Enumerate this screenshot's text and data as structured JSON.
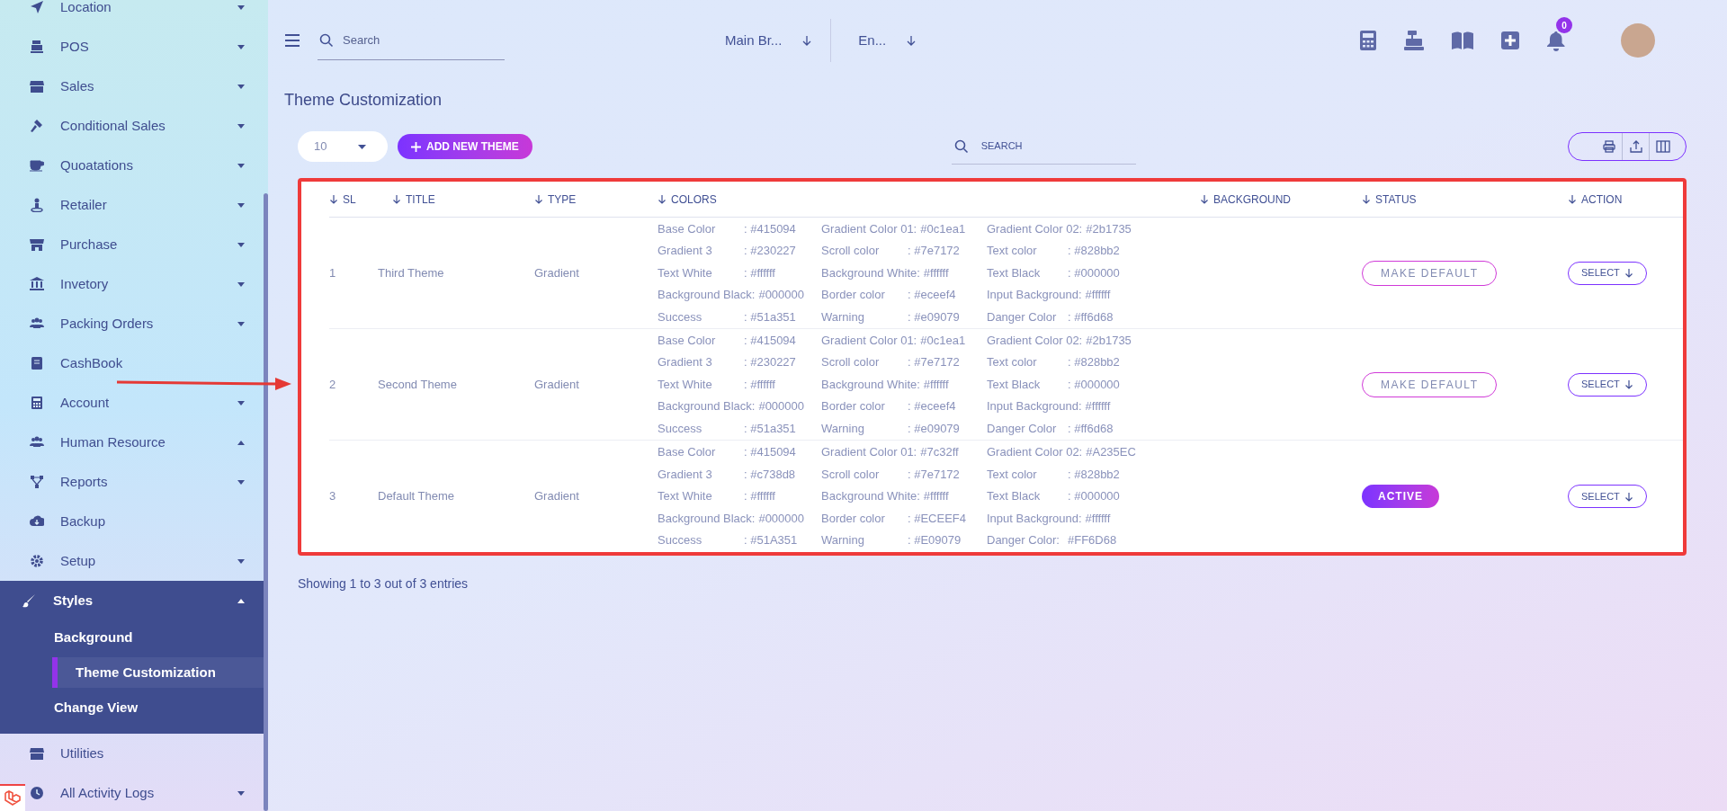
{
  "sidebar": {
    "items": [
      {
        "label": "Location",
        "kind": "dropdown",
        "expanded": false
      },
      {
        "label": "POS",
        "kind": "dropdown",
        "expanded": false
      },
      {
        "label": "Sales",
        "kind": "dropdown",
        "expanded": false
      },
      {
        "label": "Conditional Sales",
        "kind": "dropdown",
        "expanded": false
      },
      {
        "label": "Quoatations",
        "kind": "dropdown",
        "expanded": false
      },
      {
        "label": "Retailer",
        "kind": "dropdown",
        "expanded": false
      },
      {
        "label": "Purchase",
        "kind": "dropdown",
        "expanded": false
      },
      {
        "label": "Invetory",
        "kind": "dropdown",
        "expanded": false
      },
      {
        "label": "Packing Orders",
        "kind": "dropdown",
        "expanded": false
      },
      {
        "label": "CashBook",
        "kind": "link",
        "expanded": false
      },
      {
        "label": "Account",
        "kind": "dropdown",
        "expanded": false
      },
      {
        "label": "Human Resource",
        "kind": "dropup",
        "expanded": false
      },
      {
        "label": "Reports",
        "kind": "dropdown",
        "expanded": false
      },
      {
        "label": "Backup",
        "kind": "link",
        "expanded": false
      },
      {
        "label": "Setup",
        "kind": "dropdown",
        "expanded": false
      },
      {
        "label": "Styles",
        "kind": "dropup",
        "expanded": true,
        "children": [
          {
            "label": "Background",
            "selected": false
          },
          {
            "label": "Theme Customization",
            "selected": true
          },
          {
            "label": "Change View",
            "selected": false
          }
        ]
      },
      {
        "label": "Utilities",
        "kind": "link",
        "expanded": false
      },
      {
        "label": "All Activity Logs",
        "kind": "dropdown",
        "expanded": false
      }
    ]
  },
  "topbar": {
    "search": {
      "placeholder": "Search"
    },
    "branch": "Main Br...",
    "language": "En...",
    "notification_count": "0"
  },
  "page_title": "Theme Customization",
  "toolbar": {
    "page_size": "10",
    "add_button": "ADD NEW THEME",
    "search": {
      "placeholder": "SEARCH"
    }
  },
  "table": {
    "columns": [
      "SL",
      "TITLE",
      "TYPE",
      "COLORS",
      "BACKGROUND",
      "STATUS",
      "ACTION"
    ],
    "rows": [
      {
        "sl": "1",
        "title": "Third Theme",
        "type": "Gradient",
        "colors": [
          [
            {
              "label": "Base Color",
              "value": ": #415094"
            },
            {
              "label": "Gradient Color 01:",
              "value": "#0c1ea1"
            },
            {
              "label": "Gradient Color 02:",
              "value": "#2b1735"
            }
          ],
          [
            {
              "label": "Gradient 3",
              "value": ": #230227"
            },
            {
              "label": "Scroll color",
              "value": ": #7e7172"
            },
            {
              "label": "Text color",
              "value": ": #828bb2"
            }
          ],
          [
            {
              "label": "Text White",
              "value": ": #ffffff"
            },
            {
              "label": "Background White:",
              "value": "#ffffff"
            },
            {
              "label": "Text Black",
              "value": ": #000000"
            }
          ],
          [
            {
              "label": "Background Black:",
              "value": "#000000"
            },
            {
              "label": "Border color",
              "value": ": #eceef4"
            },
            {
              "label": "Input Background:",
              "value": "#ffffff"
            }
          ],
          [
            {
              "label": "Success",
              "value": ": #51a351"
            },
            {
              "label": "Warning",
              "value": ": #e09079"
            },
            {
              "label": "Danger Color",
              "value": ": #ff6d68"
            }
          ]
        ],
        "status": {
          "label": "MAKE DEFAULT",
          "active": false
        },
        "action": "SELECT"
      },
      {
        "sl": "2",
        "title": "Second Theme",
        "type": "Gradient",
        "colors": [
          [
            {
              "label": "Base Color",
              "value": ": #415094"
            },
            {
              "label": "Gradient Color 01:",
              "value": "#0c1ea1"
            },
            {
              "label": "Gradient Color 02:",
              "value": "#2b1735"
            }
          ],
          [
            {
              "label": "Gradient 3",
              "value": ": #230227"
            },
            {
              "label": "Scroll color",
              "value": ": #7e7172"
            },
            {
              "label": "Text color",
              "value": ": #828bb2"
            }
          ],
          [
            {
              "label": "Text White",
              "value": ": #ffffff"
            },
            {
              "label": "Background White:",
              "value": "#ffffff"
            },
            {
              "label": "Text Black",
              "value": ": #000000"
            }
          ],
          [
            {
              "label": "Background Black:",
              "value": "#000000"
            },
            {
              "label": "Border color",
              "value": ": #eceef4"
            },
            {
              "label": "Input Background:",
              "value": "#ffffff"
            }
          ],
          [
            {
              "label": "Success",
              "value": ": #51a351"
            },
            {
              "label": "Warning",
              "value": ": #e09079"
            },
            {
              "label": "Danger Color",
              "value": ": #ff6d68"
            }
          ]
        ],
        "status": {
          "label": "MAKE DEFAULT",
          "active": false
        },
        "action": "SELECT"
      },
      {
        "sl": "3",
        "title": "Default Theme",
        "type": "Gradient",
        "colors": [
          [
            {
              "label": "Base Color",
              "value": ": #415094"
            },
            {
              "label": "Gradient Color 01:",
              "value": "#7c32ff"
            },
            {
              "label": "Gradient Color 02:",
              "value": "#A235EC"
            }
          ],
          [
            {
              "label": "Gradient 3",
              "value": ": #c738d8"
            },
            {
              "label": "Scroll color",
              "value": ": #7e7172"
            },
            {
              "label": "Text color",
              "value": ": #828bb2"
            }
          ],
          [
            {
              "label": "Text White",
              "value": ": #ffffff"
            },
            {
              "label": "Background White:",
              "value": "#ffffff"
            },
            {
              "label": "Text Black",
              "value": ": #000000"
            }
          ],
          [
            {
              "label": "Background Black:",
              "value": "#000000"
            },
            {
              "label": "Border color",
              "value": ": #ECEEF4"
            },
            {
              "label": "Input Background:",
              "value": "#ffffff"
            }
          ],
          [
            {
              "label": "Success",
              "value": ": #51A351"
            },
            {
              "label": "Warning",
              "value": ": #E09079"
            },
            {
              "label": "Danger Color:",
              "value": "#FF6D68"
            }
          ]
        ],
        "status": {
          "label": "ACTIVE",
          "active": true
        },
        "action": "SELECT"
      }
    ]
  },
  "footer": "Showing 1 to 3 out of 3 entries"
}
